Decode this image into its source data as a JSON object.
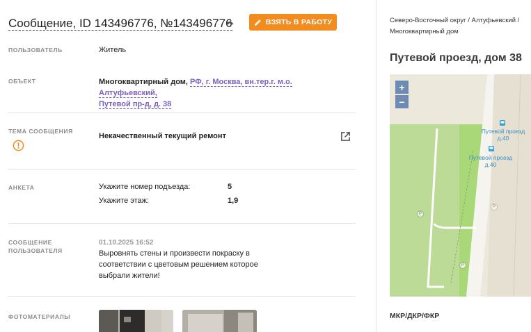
{
  "header": {
    "title": "Сообщение, ID 143496776, №143496776",
    "take_button": "ВЗЯТЬ В РАБОТУ"
  },
  "fields": {
    "user_label": "ПОЛЬЗОВАТЕЛЬ",
    "user_value": "Житель",
    "object_label": "ОБЪЕКТ",
    "object_type": "Многоквартирный дом,",
    "object_address_line1": "РФ, г. Москва, вн.тер.г. м.о. Алтуфьевский,",
    "object_address_line2": "Путевой пр-д, д. 38",
    "topic_label": "ТЕМА СООБЩЕНИЯ",
    "topic_value": "Некачественный текущий ремонт",
    "survey_label": "АНКЕТА",
    "survey": [
      {
        "question": "Укажите номер подъезда:",
        "answer": "5"
      },
      {
        "question": "Укажите этаж:",
        "answer": "1,9"
      }
    ],
    "message_label_line1": "СООБЩЕНИЕ",
    "message_label_line2": "ПОЛЬЗОВАТЕЛЯ",
    "message_date": "01.10.2025 16:52",
    "message_text": "Выровнять стены и произвести покраску в соответствии с цветовым решением которое выбрали жители!",
    "photos_label": "ФОТОМАТЕРИАЛЫ"
  },
  "right": {
    "breadcrumb": "Северо-Восточный округ / Алтуфьевский / Многоквартирный дом",
    "title": "Путевой проезд, дом 38",
    "zoom_in": "+",
    "zoom_out": "−",
    "stop1_line1": "Путевой проезд",
    "stop1_line2": "д.40",
    "stop2_line1": "Путевой проезд",
    "stop2_line2": "д.40",
    "parking": "P",
    "footer": "МКР/ДКР/ФКР"
  },
  "colors": {
    "accent_orange": "#f28c1f",
    "link_purple": "#7a5fc2",
    "map_green": "#a9d878"
  }
}
